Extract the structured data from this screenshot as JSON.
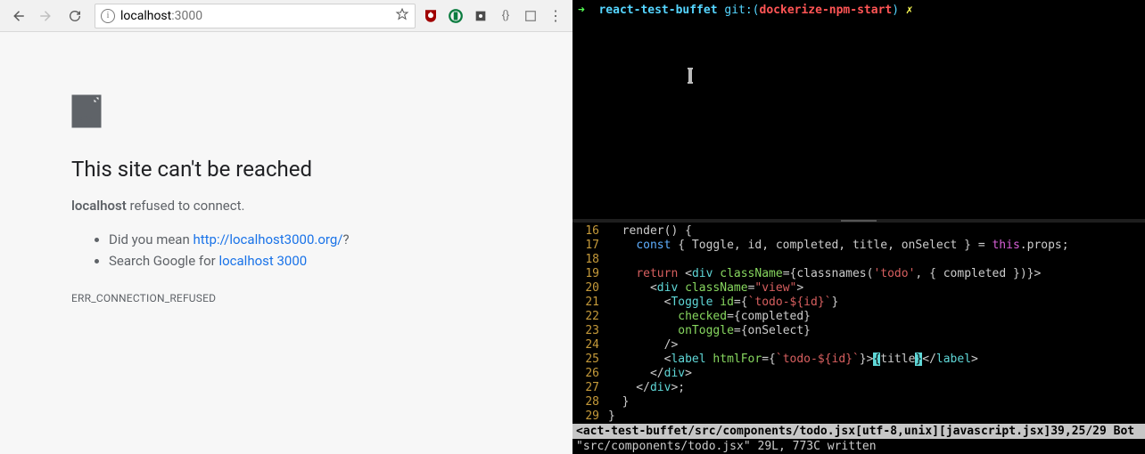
{
  "browser": {
    "url_host": "localhost",
    "url_port": ":3000",
    "error": {
      "title": "This site can't be reached",
      "subtitle_host": "localhost",
      "subtitle_rest": " refused to connect.",
      "bullet1_pre": "Did you mean ",
      "bullet1_link": "http://localhost3000.org/",
      "bullet1_post": "?",
      "bullet2_pre": "Search Google for ",
      "bullet2_link": "localhost 3000",
      "code": "ERR_CONNECTION_REFUSED"
    }
  },
  "terminal": {
    "arrow": "➜  ",
    "repo": "react-test-buffet",
    "git_word": " git:(",
    "branch": "dockerize-npm-start",
    "git_close": ")",
    "dirty": " ✗"
  },
  "editor": {
    "lines": {
      "16": "  render() {",
      "17_a": "    ",
      "17_kw": "const",
      "17_b": " { Toggle, id, completed, title, onSelect } = ",
      "17_this": "this",
      "17_c": ".props;",
      "18": "",
      "19_a": "    ",
      "19_kw": "return",
      "19_b": " <",
      "19_tag": "div",
      "19_c": " ",
      "19_attr": "className",
      "19_d": "={classnames(",
      "19_str": "'todo'",
      "19_e": ", { completed })}>",
      "20_a": "      <",
      "20_tag": "div",
      "20_b": " ",
      "20_attr": "className",
      "20_c": "=",
      "20_str": "\"view\"",
      "20_d": ">",
      "21_a": "        <",
      "21_tag": "Toggle",
      "21_b": " ",
      "21_attr": "id",
      "21_c": "={",
      "21_str": "`todo-${id}`",
      "21_d": "}",
      "22_a": "          ",
      "22_attr": "checked",
      "22_b": "={completed}",
      "23_a": "          ",
      "23_attr": "onToggle",
      "23_b": "={onSelect}",
      "24": "        />",
      "25_a": "        <",
      "25_tag": "label",
      "25_b": " ",
      "25_attr": "htmlFor",
      "25_c": "={",
      "25_str": "`todo-${id}`",
      "25_d": "}>",
      "25_cur_l": "{",
      "25_txt": "title",
      "25_cur_r": "}",
      "25_e": "</",
      "25_tag2": "label",
      "25_f": ">",
      "26_a": "      </",
      "26_tag": "div",
      "26_b": ">",
      "27_a": "    </",
      "27_tag": "div",
      "27_b": ">;",
      "28": "  }",
      "29": "}"
    },
    "status": "<act-test-buffet/src/components/todo.jsx[utf-8,unix][javascript.jsx]39,25/29 Bot",
    "cmdline": "\"src/components/todo.jsx\" 29L, 773C written"
  }
}
